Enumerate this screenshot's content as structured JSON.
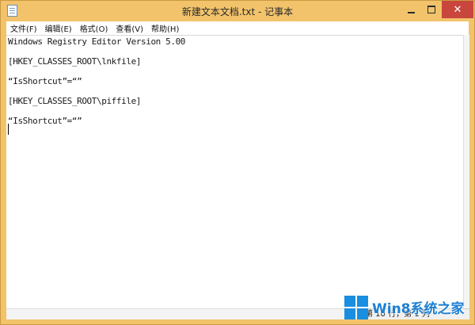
{
  "window": {
    "title": "新建文本文档.txt - 记事本",
    "close_glyph": "✕"
  },
  "menu": {
    "items": [
      "文件(F)",
      "编辑(E)",
      "格式(O)",
      "查看(V)",
      "帮助(H)"
    ]
  },
  "editor": {
    "lines": [
      "Windows Registry Editor Version 5.00",
      "[HKEY_CLASSES_ROOT\\lnkfile]",
      "“IsShortcut”=“”",
      "[HKEY_CLASSES_ROOT\\piffile]",
      "“IsShortcut”=“”"
    ]
  },
  "status": {
    "position": "第 10 行，第 1 列"
  },
  "watermark": {
    "text": "Win8系统之家"
  },
  "colors": {
    "frame": "#f2c36b",
    "close_button": "#c9463d",
    "logo_blue": "#1a8ee0"
  }
}
